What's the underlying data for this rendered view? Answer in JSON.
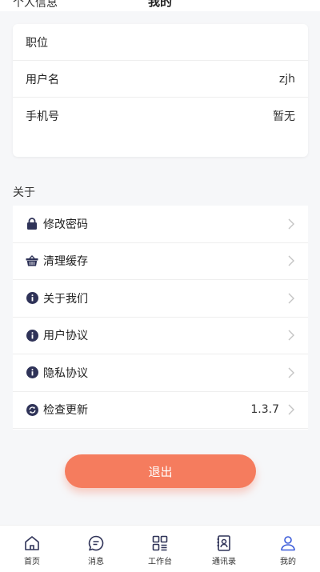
{
  "header": {
    "title": "我的"
  },
  "personal_info": {
    "section_title": "个人信息",
    "rows": [
      {
        "label": "职位",
        "value": ""
      },
      {
        "label": "用户名",
        "value": "zjh"
      },
      {
        "label": "手机号",
        "value": "暂无"
      }
    ]
  },
  "about": {
    "section_title": "关于",
    "items": [
      {
        "icon": "lock-icon",
        "label": "修改密码"
      },
      {
        "icon": "basket-icon",
        "label": "清理缓存"
      },
      {
        "icon": "info-icon",
        "label": "关于我们"
      },
      {
        "icon": "info-icon",
        "label": "用户协议"
      },
      {
        "icon": "info-icon",
        "label": "隐私协议"
      },
      {
        "icon": "refresh-icon",
        "label": "检查更新",
        "value": "1.3.7"
      }
    ]
  },
  "logout_label": "退出",
  "tabs": [
    {
      "icon": "home-icon",
      "label": "首页"
    },
    {
      "icon": "message-icon",
      "label": "消息"
    },
    {
      "icon": "workbench-icon",
      "label": "工作台"
    },
    {
      "icon": "contacts-icon",
      "label": "通讯录"
    },
    {
      "icon": "user-icon",
      "label": "我的",
      "active": true
    }
  ],
  "colors": {
    "accent": "#f57c5e",
    "icon_dark": "#2f3358",
    "active_tab": "#3a5bd9"
  }
}
